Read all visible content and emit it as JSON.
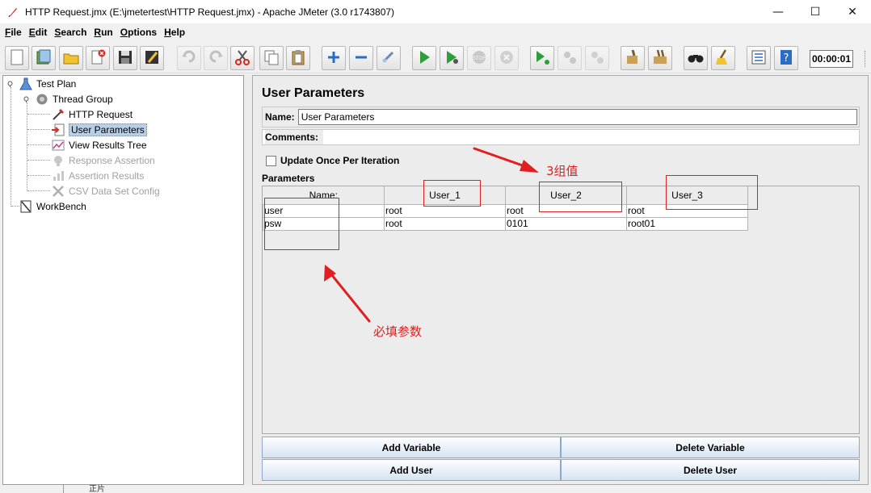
{
  "window": {
    "title": "HTTP Request.jmx (E:\\jmetertest\\HTTP Request.jmx) - Apache JMeter (3.0 r1743807)",
    "minimize": "—",
    "maximize": "☐",
    "close": "✕"
  },
  "menu": [
    {
      "key": "F",
      "rest": "ile"
    },
    {
      "key": "E",
      "rest": "dit"
    },
    {
      "key": "S",
      "rest": "earch"
    },
    {
      "key": "R",
      "rest": "un"
    },
    {
      "key": "O",
      "rest": "ptions"
    },
    {
      "key": "H",
      "rest": "elp"
    }
  ],
  "toolbar": {
    "timer": "00:00:01",
    "icons": [
      "new-icon",
      "templates-icon",
      "open-icon",
      "close-file-icon",
      "save-icon",
      "save-as-icon",
      "undo-icon",
      "redo-icon",
      "cut-icon",
      "copy-icon",
      "paste-icon",
      "expand-icon",
      "collapse-icon",
      "toggle-icon",
      "start-icon",
      "start-no-pauses-icon",
      "stop-icon",
      "shutdown-icon",
      "remote-start-icon",
      "remote-stop-icon",
      "remote-shutdown-icon",
      "clear-icon",
      "clear-all-icon",
      "search-icon",
      "reset-search-icon",
      "function-helper-icon",
      "help-icon"
    ]
  },
  "tree": {
    "nodes": [
      {
        "label": "Test Plan",
        "icon": "test-plan-icon",
        "enabled": true,
        "selected": false
      },
      {
        "label": "Thread Group",
        "icon": "thread-group-icon",
        "enabled": true,
        "selected": false
      },
      {
        "label": "HTTP Request",
        "icon": "sampler-icon",
        "enabled": true,
        "selected": false
      },
      {
        "label": "User Parameters",
        "icon": "preprocessor-icon",
        "enabled": true,
        "selected": true
      },
      {
        "label": "View Results Tree",
        "icon": "listener-icon",
        "enabled": true,
        "selected": false
      },
      {
        "label": "Response Assertion",
        "icon": "assertion-icon",
        "enabled": false,
        "selected": false
      },
      {
        "label": "Assertion Results",
        "icon": "listener-icon",
        "enabled": false,
        "selected": false
      },
      {
        "label": "CSV Data Set Config",
        "icon": "config-icon",
        "enabled": false,
        "selected": false
      },
      {
        "label": "WorkBench",
        "icon": "workbench-icon",
        "enabled": true,
        "selected": false
      }
    ]
  },
  "main": {
    "title": "User Parameters",
    "name_label": "Name:",
    "name_value": "User Parameters",
    "comments_label": "Comments:",
    "comments_value": "",
    "update_once_label": "Update Once Per Iteration",
    "update_once_checked": false,
    "parameters_label": "Parameters",
    "columns": [
      "Name:",
      "User_1",
      "User_2",
      "User_3"
    ],
    "rows": [
      [
        "user",
        "root",
        "root",
        "root"
      ],
      [
        "psw",
        "root",
        "0101",
        "root01"
      ]
    ],
    "buttons": {
      "add_variable": "Add Variable",
      "delete_variable": "Delete Variable",
      "add_user": "Add User",
      "delete_user": "Delete User"
    }
  },
  "annotations": {
    "three_groups": "3组值",
    "required_params": "必填参数",
    "color": "#e02020"
  },
  "footer": {
    "fragment": "正片"
  }
}
